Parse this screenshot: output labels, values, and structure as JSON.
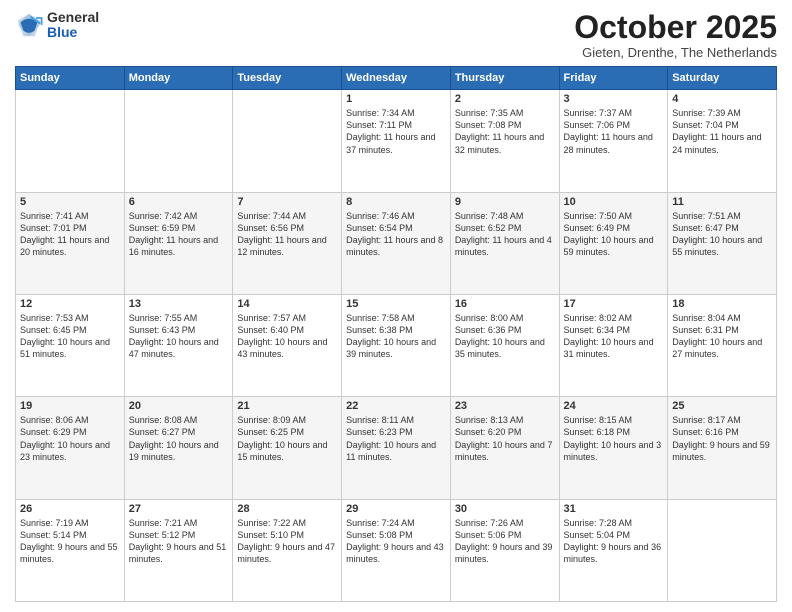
{
  "logo": {
    "general": "General",
    "blue": "Blue"
  },
  "header": {
    "month": "October 2025",
    "location": "Gieten, Drenthe, The Netherlands"
  },
  "weekdays": [
    "Sunday",
    "Monday",
    "Tuesday",
    "Wednesday",
    "Thursday",
    "Friday",
    "Saturday"
  ],
  "weeks": [
    [
      {
        "day": "",
        "info": ""
      },
      {
        "day": "",
        "info": ""
      },
      {
        "day": "",
        "info": ""
      },
      {
        "day": "1",
        "info": "Sunrise: 7:34 AM\nSunset: 7:11 PM\nDaylight: 11 hours and 37 minutes."
      },
      {
        "day": "2",
        "info": "Sunrise: 7:35 AM\nSunset: 7:08 PM\nDaylight: 11 hours and 32 minutes."
      },
      {
        "day": "3",
        "info": "Sunrise: 7:37 AM\nSunset: 7:06 PM\nDaylight: 11 hours and 28 minutes."
      },
      {
        "day": "4",
        "info": "Sunrise: 7:39 AM\nSunset: 7:04 PM\nDaylight: 11 hours and 24 minutes."
      }
    ],
    [
      {
        "day": "5",
        "info": "Sunrise: 7:41 AM\nSunset: 7:01 PM\nDaylight: 11 hours and 20 minutes."
      },
      {
        "day": "6",
        "info": "Sunrise: 7:42 AM\nSunset: 6:59 PM\nDaylight: 11 hours and 16 minutes."
      },
      {
        "day": "7",
        "info": "Sunrise: 7:44 AM\nSunset: 6:56 PM\nDaylight: 11 hours and 12 minutes."
      },
      {
        "day": "8",
        "info": "Sunrise: 7:46 AM\nSunset: 6:54 PM\nDaylight: 11 hours and 8 minutes."
      },
      {
        "day": "9",
        "info": "Sunrise: 7:48 AM\nSunset: 6:52 PM\nDaylight: 11 hours and 4 minutes."
      },
      {
        "day": "10",
        "info": "Sunrise: 7:50 AM\nSunset: 6:49 PM\nDaylight: 10 hours and 59 minutes."
      },
      {
        "day": "11",
        "info": "Sunrise: 7:51 AM\nSunset: 6:47 PM\nDaylight: 10 hours and 55 minutes."
      }
    ],
    [
      {
        "day": "12",
        "info": "Sunrise: 7:53 AM\nSunset: 6:45 PM\nDaylight: 10 hours and 51 minutes."
      },
      {
        "day": "13",
        "info": "Sunrise: 7:55 AM\nSunset: 6:43 PM\nDaylight: 10 hours and 47 minutes."
      },
      {
        "day": "14",
        "info": "Sunrise: 7:57 AM\nSunset: 6:40 PM\nDaylight: 10 hours and 43 minutes."
      },
      {
        "day": "15",
        "info": "Sunrise: 7:58 AM\nSunset: 6:38 PM\nDaylight: 10 hours and 39 minutes."
      },
      {
        "day": "16",
        "info": "Sunrise: 8:00 AM\nSunset: 6:36 PM\nDaylight: 10 hours and 35 minutes."
      },
      {
        "day": "17",
        "info": "Sunrise: 8:02 AM\nSunset: 6:34 PM\nDaylight: 10 hours and 31 minutes."
      },
      {
        "day": "18",
        "info": "Sunrise: 8:04 AM\nSunset: 6:31 PM\nDaylight: 10 hours and 27 minutes."
      }
    ],
    [
      {
        "day": "19",
        "info": "Sunrise: 8:06 AM\nSunset: 6:29 PM\nDaylight: 10 hours and 23 minutes."
      },
      {
        "day": "20",
        "info": "Sunrise: 8:08 AM\nSunset: 6:27 PM\nDaylight: 10 hours and 19 minutes."
      },
      {
        "day": "21",
        "info": "Sunrise: 8:09 AM\nSunset: 6:25 PM\nDaylight: 10 hours and 15 minutes."
      },
      {
        "day": "22",
        "info": "Sunrise: 8:11 AM\nSunset: 6:23 PM\nDaylight: 10 hours and 11 minutes."
      },
      {
        "day": "23",
        "info": "Sunrise: 8:13 AM\nSunset: 6:20 PM\nDaylight: 10 hours and 7 minutes."
      },
      {
        "day": "24",
        "info": "Sunrise: 8:15 AM\nSunset: 6:18 PM\nDaylight: 10 hours and 3 minutes."
      },
      {
        "day": "25",
        "info": "Sunrise: 8:17 AM\nSunset: 6:16 PM\nDaylight: 9 hours and 59 minutes."
      }
    ],
    [
      {
        "day": "26",
        "info": "Sunrise: 7:19 AM\nSunset: 5:14 PM\nDaylight: 9 hours and 55 minutes."
      },
      {
        "day": "27",
        "info": "Sunrise: 7:21 AM\nSunset: 5:12 PM\nDaylight: 9 hours and 51 minutes."
      },
      {
        "day": "28",
        "info": "Sunrise: 7:22 AM\nSunset: 5:10 PM\nDaylight: 9 hours and 47 minutes."
      },
      {
        "day": "29",
        "info": "Sunrise: 7:24 AM\nSunset: 5:08 PM\nDaylight: 9 hours and 43 minutes."
      },
      {
        "day": "30",
        "info": "Sunrise: 7:26 AM\nSunset: 5:06 PM\nDaylight: 9 hours and 39 minutes."
      },
      {
        "day": "31",
        "info": "Sunrise: 7:28 AM\nSunset: 5:04 PM\nDaylight: 9 hours and 36 minutes."
      },
      {
        "day": "",
        "info": ""
      }
    ]
  ]
}
